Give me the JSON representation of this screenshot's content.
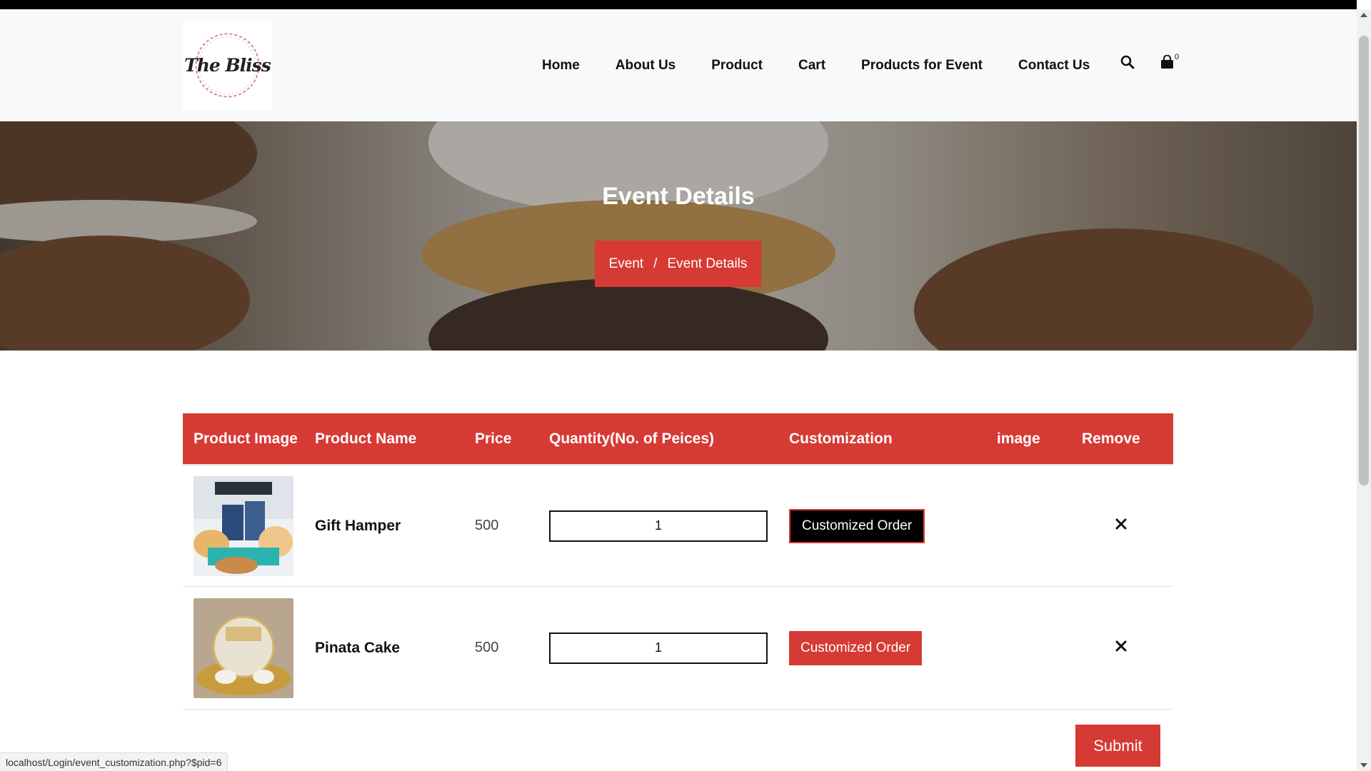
{
  "brand": {
    "logo_text": "The Bliss"
  },
  "nav": {
    "items": [
      {
        "label": "Home"
      },
      {
        "label": "About Us"
      },
      {
        "label": "Product"
      },
      {
        "label": "Cart"
      },
      {
        "label": "Products for Event"
      },
      {
        "label": "Contact Us"
      }
    ],
    "cart_count": "0",
    "search_icon": "search-icon",
    "cart_icon": "shopping-bag-icon"
  },
  "hero": {
    "title": "Event Details",
    "breadcrumb": {
      "parent": "Event",
      "separator": "/",
      "current": "Event Details"
    }
  },
  "table": {
    "headers": [
      "Product Image",
      "Product Name",
      "Price",
      "Quantity(No. of Peices)",
      "Customization",
      "image",
      "Remove"
    ],
    "rows": [
      {
        "name": "Gift Hamper",
        "price": "500",
        "quantity": "1",
        "customize_label": "Customized Order",
        "remove_icon": "close-icon"
      },
      {
        "name": "Pinata Cake",
        "price": "500",
        "quantity": "1",
        "customize_label": "Customized Order",
        "remove_icon": "close-icon"
      }
    ]
  },
  "submit_label": "Submit",
  "status_url": "localhost/Login/event_customization.php?$pid=6",
  "colors": {
    "accent": "#d63a34",
    "dark": "#000000",
    "header_bg": "#f8f9fa"
  }
}
